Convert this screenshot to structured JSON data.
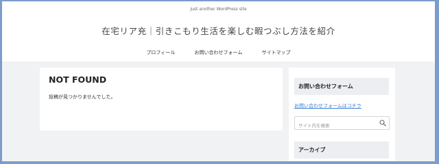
{
  "header": {
    "tagline": "Just another WordPress site",
    "site_title": "在宅リア充｜引きこもり生活を楽しむ暇つぶし方法を紹介"
  },
  "nav": {
    "items": [
      "プロフィール",
      "お問い合わせフォーム",
      "サイトマップ"
    ]
  },
  "main": {
    "title": "NOT FOUND",
    "message": "投稿が見つかりませんでした。"
  },
  "sidebar": {
    "contact_heading": "お問い合わせフォーム",
    "contact_link": "お問い合わせフォームはコチラ",
    "search_placeholder": "サイト内を検索",
    "archive_heading": "アーカイブ"
  }
}
